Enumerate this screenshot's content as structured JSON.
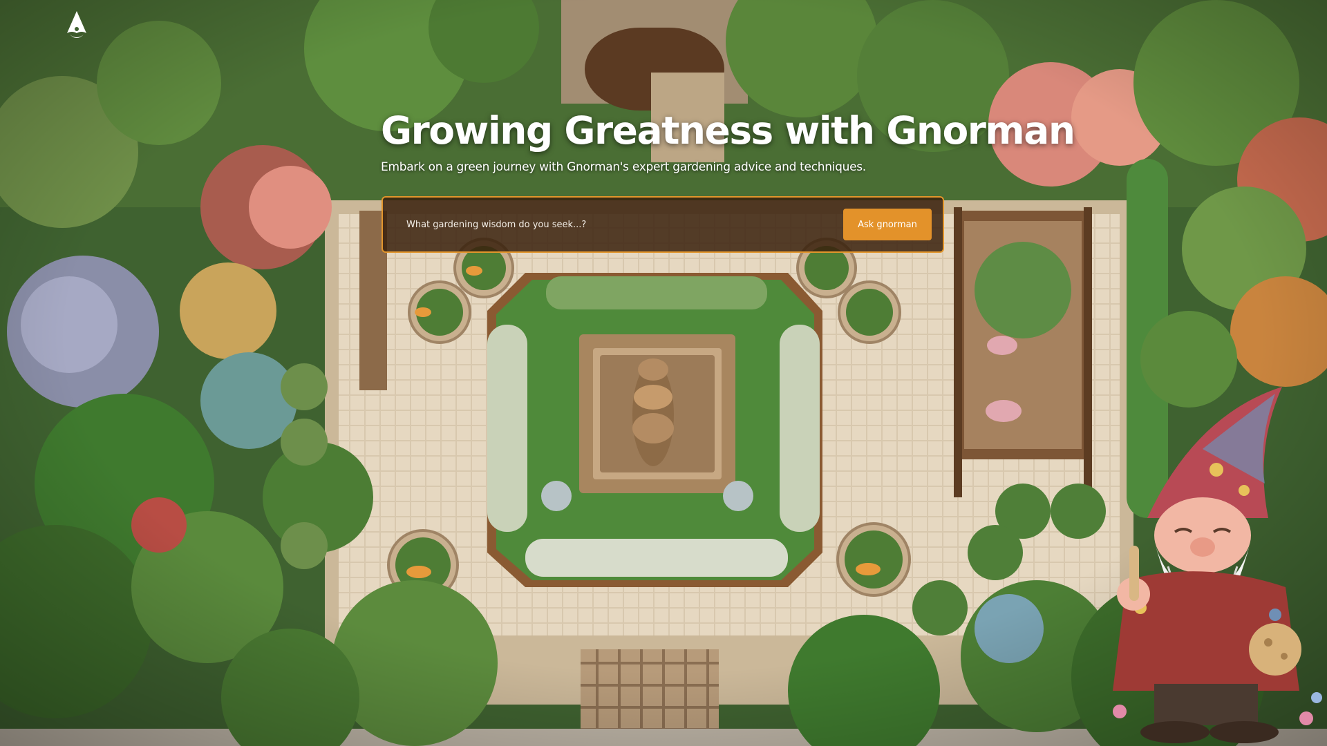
{
  "page": {
    "accent_color": "#e3922a"
  },
  "header": {
    "logo_icon": "gnome-hat-logo-icon"
  },
  "hero": {
    "title": "Growing Greatness with Gnorman",
    "subtitle": "Embark on a green journey with Gnorman's expert gardening advice and techniques."
  },
  "search": {
    "placeholder": "What gardening wisdom do you seek...?",
    "value": "",
    "button_label": "Ask gnorman"
  },
  "decor": {
    "background": "garden-courtyard-illustration",
    "mascot": "gnome-mascot-illustration"
  }
}
